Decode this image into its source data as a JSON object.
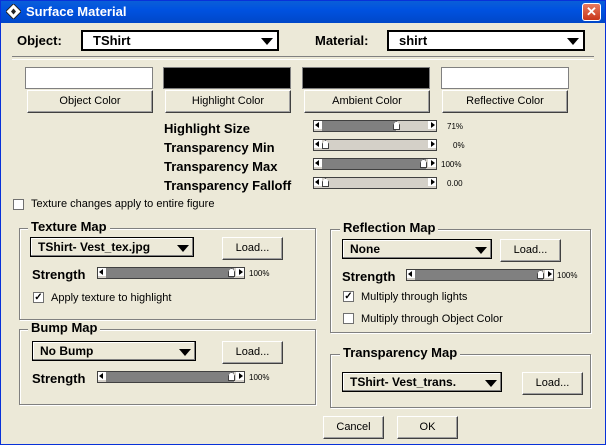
{
  "window": {
    "title": "Surface Material",
    "close_glyph": "✕",
    "icon": "logo-icon"
  },
  "object": {
    "label": "Object:",
    "value": "TShirt"
  },
  "material": {
    "label": "Material:",
    "value": "shirt"
  },
  "colors": [
    {
      "label": "Object Color",
      "swatch": "#ffffff"
    },
    {
      "label": "Highlight Color",
      "swatch": "#000000"
    },
    {
      "label": "Ambient Color",
      "swatch": "#000000"
    },
    {
      "label": "Reflective Color",
      "swatch": "#ffffff"
    }
  ],
  "params": [
    {
      "label": "Highlight Size",
      "value": "71%",
      "level": 0.71
    },
    {
      "label": "Transparency Min",
      "value": "0%",
      "level": 0.0
    },
    {
      "label": "Transparency Max",
      "value": "100%",
      "level": 1.0
    },
    {
      "label": "Transparency Falloff",
      "value": "0.00",
      "level": 0.0
    }
  ],
  "texture_changes": {
    "label": "Texture changes apply to entire figure",
    "checked": false
  },
  "texture_map": {
    "title": "Texture Map",
    "file": "TShirt- Vest_tex.jpg",
    "load": "Load...",
    "strength_label": "Strength",
    "strength_value": "100%",
    "strength_level": 1.0,
    "highlight_label": "Apply texture to highlight",
    "highlight_checked": true
  },
  "bump_map": {
    "title": "Bump Map",
    "file": "No Bump",
    "load": "Load...",
    "strength_label": "Strength",
    "strength_value": "100%",
    "strength_level": 1.0
  },
  "reflection_map": {
    "title": "Reflection Map",
    "file": "None",
    "load": "Load...",
    "strength_label": "Strength",
    "strength_value": "100%",
    "strength_level": 1.0,
    "lights_label": "Multiply through lights",
    "lights_checked": true,
    "objcolor_label": "Multiply through Object Color",
    "objcolor_checked": false
  },
  "transparency_map": {
    "title": "Transparency Map",
    "file": "TShirt- Vest_trans.",
    "load": "Load..."
  },
  "buttons": {
    "cancel": "Cancel",
    "ok": "OK"
  }
}
